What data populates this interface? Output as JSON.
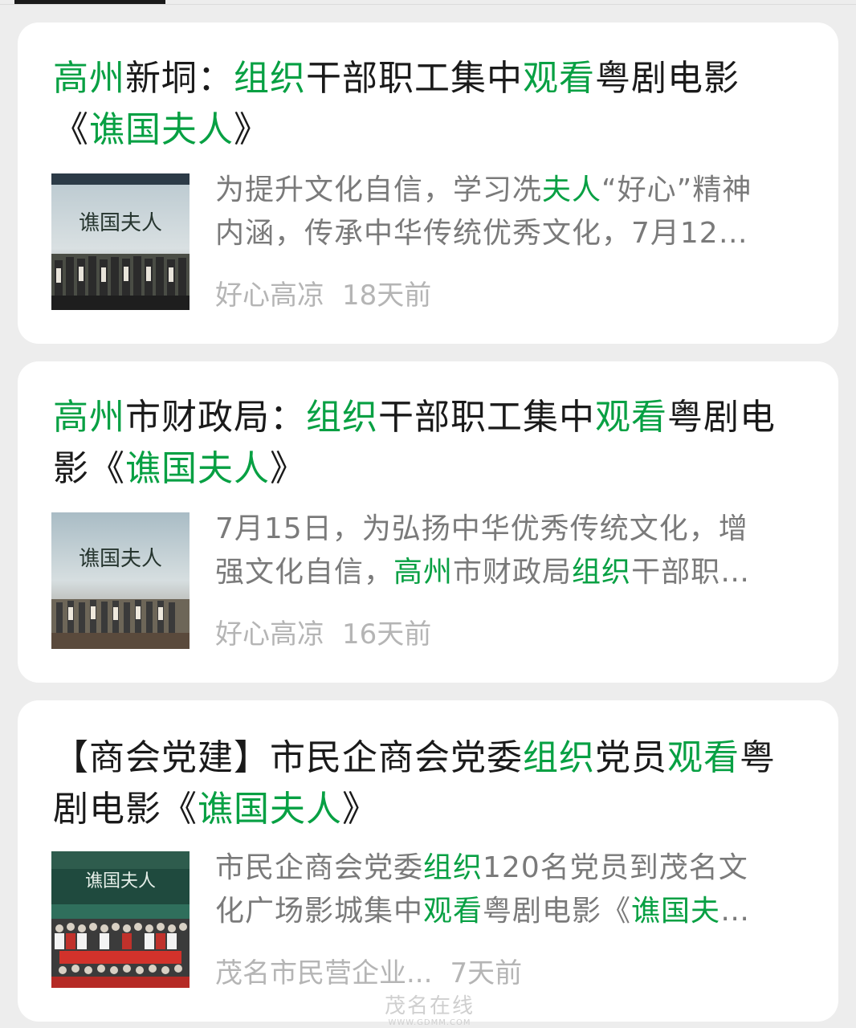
{
  "results": [
    {
      "title": [
        {
          "t": "高州",
          "h": true
        },
        {
          "t": "新垌：",
          "h": false
        },
        {
          "t": "组织",
          "h": true
        },
        {
          "t": "干部职工集中",
          "h": false
        },
        {
          "t": "观看",
          "h": true
        },
        {
          "t": "粤剧电影",
          "h": false
        },
        {
          "t": "《",
          "h": false
        },
        {
          "t": "谯国夫人",
          "h": true
        },
        {
          "t": "》",
          "h": false
        }
      ],
      "snippet_line1": [
        {
          "t": "为提升文化自信，学习冼",
          "h": false
        },
        {
          "t": "夫人",
          "h": true
        },
        {
          "t": "“好心”精神",
          "h": false
        }
      ],
      "snippet_line2": [
        {
          "t": "内涵，传承中华传统优秀文化，7月12…",
          "h": false
        }
      ],
      "source": "好心高凉",
      "time": "18天前",
      "thumb_caption": "谯国夫人"
    },
    {
      "title": [
        {
          "t": "高州",
          "h": true
        },
        {
          "t": "市财政局：",
          "h": false
        },
        {
          "t": "组织",
          "h": true
        },
        {
          "t": "干部职工集中",
          "h": false
        },
        {
          "t": "观看",
          "h": true
        },
        {
          "t": "粤剧电影",
          "h": false
        },
        {
          "t": "《",
          "h": false
        },
        {
          "t": "谯国夫人",
          "h": true
        },
        {
          "t": "》",
          "h": false
        }
      ],
      "snippet_line1": [
        {
          "t": "7月15日，为弘扬中华优秀传统文化，增",
          "h": false
        }
      ],
      "snippet_line2": [
        {
          "t": "强文化自信，",
          "h": false
        },
        {
          "t": "高州",
          "h": true
        },
        {
          "t": "市财政局",
          "h": false
        },
        {
          "t": "组织",
          "h": true
        },
        {
          "t": "干部职…",
          "h": false
        }
      ],
      "source": "好心高凉",
      "time": "16天前",
      "thumb_caption": "谯国夫人"
    },
    {
      "title": [
        {
          "t": "【商会党建】市民企商会党委",
          "h": false
        },
        {
          "t": "组织",
          "h": true
        },
        {
          "t": "党员",
          "h": false
        },
        {
          "t": "观看",
          "h": true
        },
        {
          "t": "粤剧电影",
          "h": false
        },
        {
          "t": "《",
          "h": false
        },
        {
          "t": "谯国夫人",
          "h": true
        },
        {
          "t": "》",
          "h": false
        }
      ],
      "snippet_line1": [
        {
          "t": "市民企商会党委",
          "h": false
        },
        {
          "t": "组织",
          "h": true
        },
        {
          "t": "120名党员到茂名文",
          "h": false
        }
      ],
      "snippet_line2": [
        {
          "t": "化广场影城集中",
          "h": false
        },
        {
          "t": "观看",
          "h": true
        },
        {
          "t": "粤剧电影《",
          "h": false
        },
        {
          "t": "谯国夫",
          "h": true
        },
        {
          "t": "…",
          "h": false
        }
      ],
      "source": "茂名市民营企业...",
      "time": "7天前",
      "thumb_caption": "谯国夫人"
    }
  ],
  "watermark": {
    "main": "茂名在线",
    "sub": "WWW.GDMM.COM"
  },
  "colors": {
    "highlight": "#07a043",
    "text": "#1a1a1a",
    "snippet": "#7a7a7a",
    "meta": "#b5b5b5"
  }
}
